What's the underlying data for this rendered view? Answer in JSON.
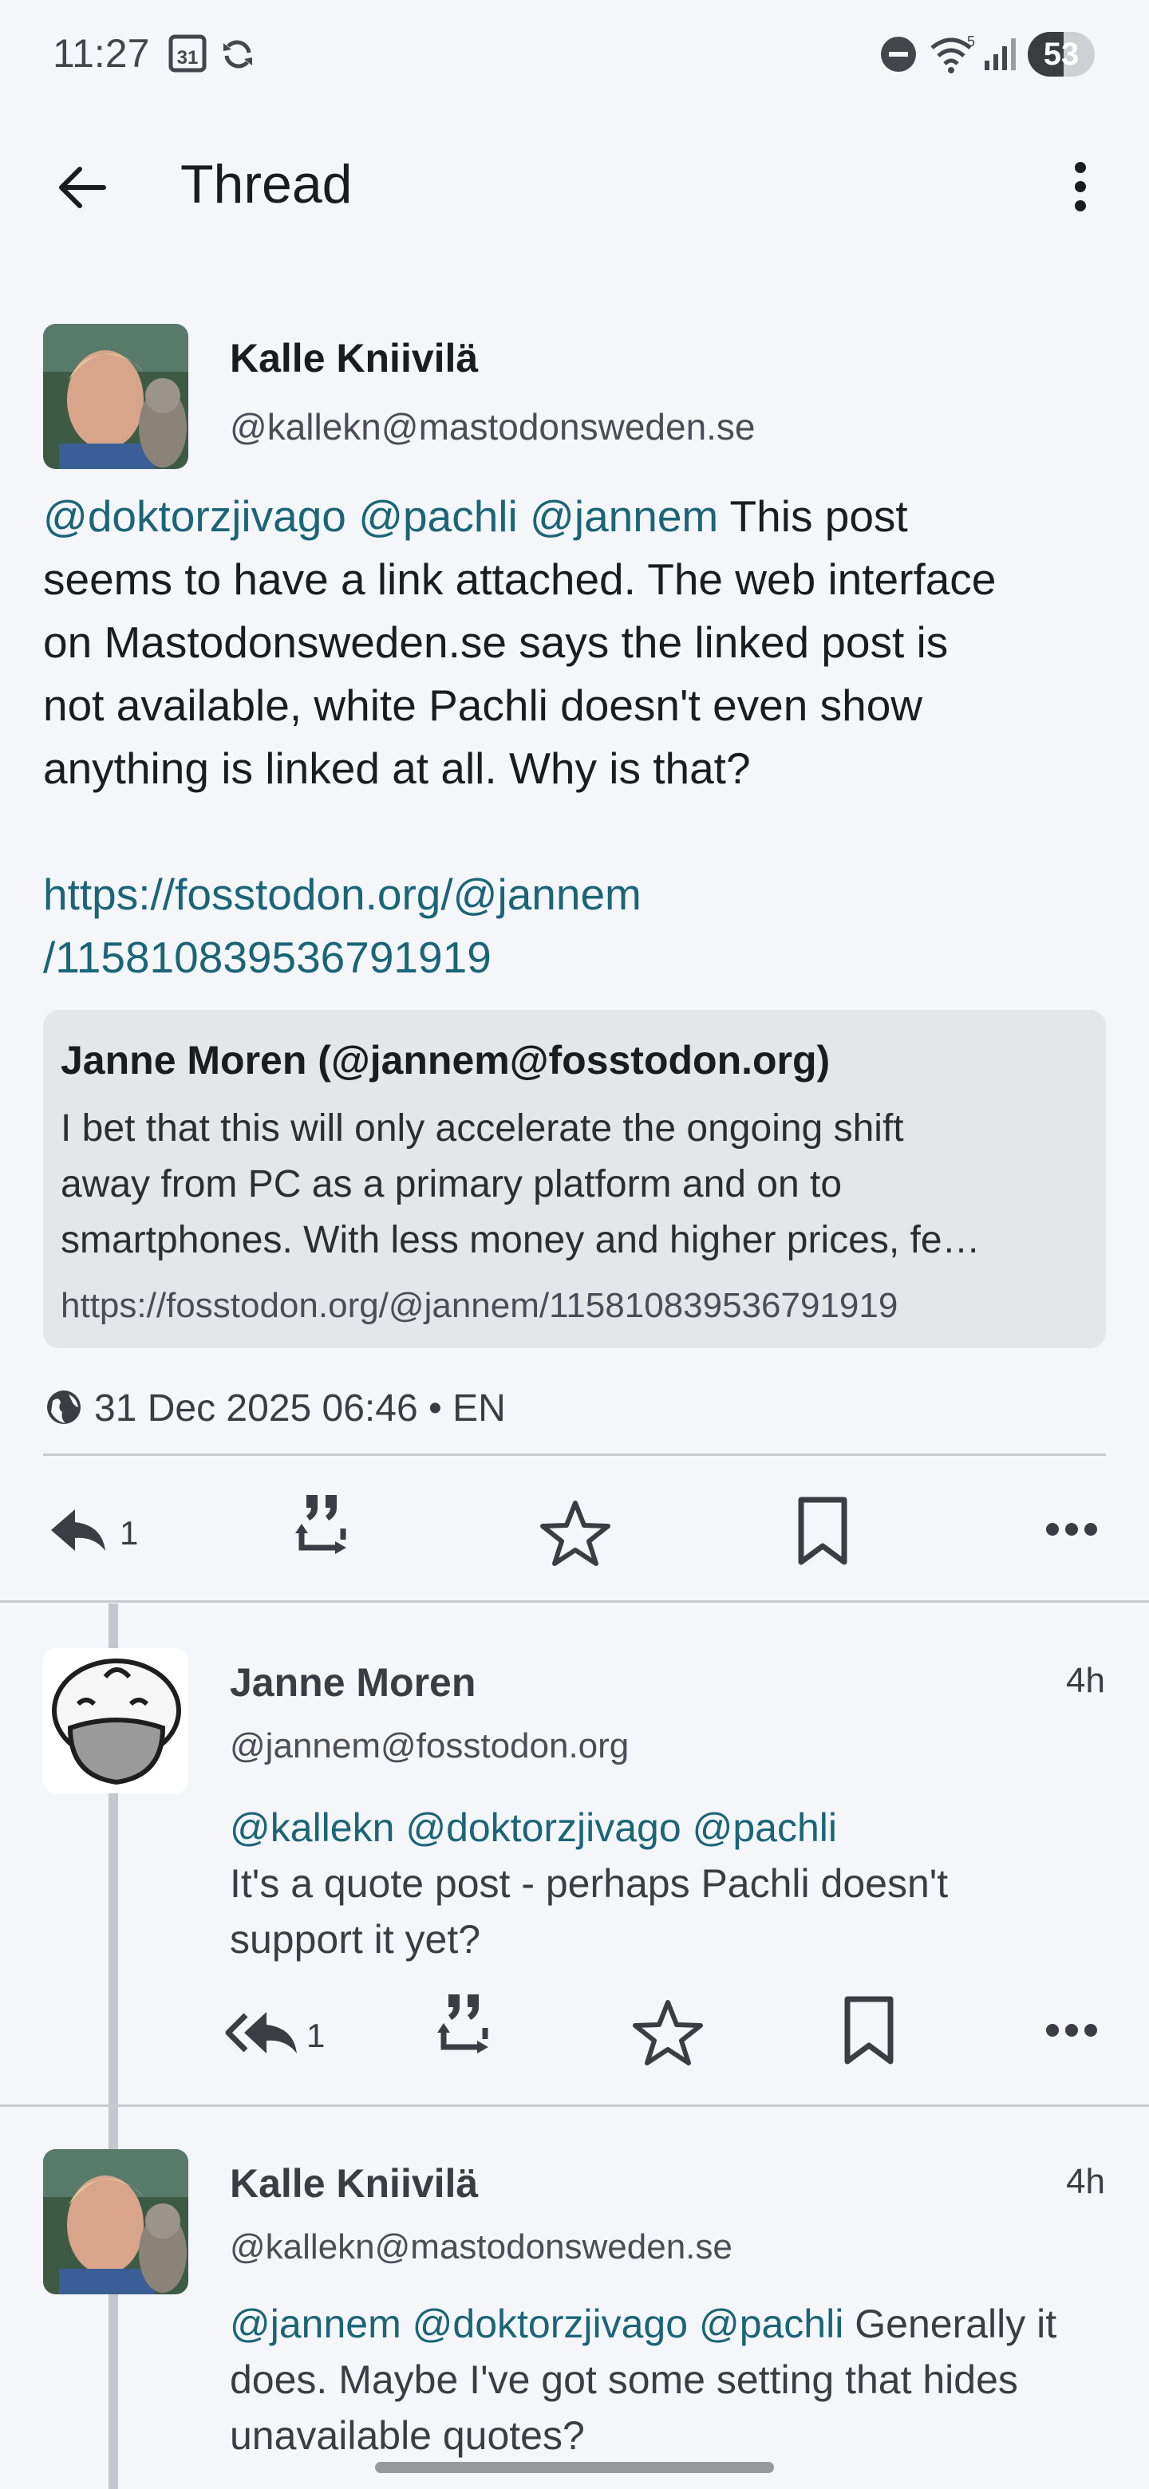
{
  "status_bar": {
    "time": "11:27",
    "calendar_day": "31",
    "network": "5",
    "battery": "53",
    "battery_level": 0.53
  },
  "app_bar": {
    "title": "Thread"
  },
  "main_post": {
    "author_name": "Kalle Kniivilä",
    "author_handle": "@kallekn@mastodonsweden.se",
    "mentions": [
      "@doktorzjivago",
      "@pachli",
      "@jannem"
    ],
    "text_lines": [
      "This post",
      "seems to have a link attached. The web interface",
      "on Mastodonsweden.se says the linked post is",
      "not available, white Pachli doesn't even show",
      "anything is linked at all. Why is that?"
    ],
    "link_lines": [
      "https://fosstodon.org/@jannem",
      "/115810839536791919"
    ],
    "quote": {
      "author": "Janne Moren (@jannem@fosstodon.org)",
      "text_lines": [
        "I bet that this will only accelerate the ongoing shift",
        "away from PC as a primary platform and on to",
        "smartphones. With less money and higher prices, fe…"
      ],
      "url": "https://fosstodon.org/@jannem/115810839536791919"
    },
    "meta": "31 Dec 2025 06:46 • EN",
    "reply_count": "1"
  },
  "reply1": {
    "author_name": "Janne Moren",
    "author_handle": "@jannem@fosstodon.org",
    "time": "4h",
    "mentions": [
      "@kallekn",
      "@doktorzjivago",
      "@pachli"
    ],
    "text_lines": [
      "It's a quote post - perhaps Pachli doesn't",
      "support it yet?"
    ],
    "reply_count": "1"
  },
  "reply2": {
    "author_name": "Kalle Kniivilä",
    "author_handle": "@kallekn@mastodonsweden.se",
    "time": "4h",
    "mentions": [
      "@jannem",
      "@doktorzjivago",
      "@pachli"
    ],
    "text_lines": [
      "Generally it",
      "does. Maybe I've got some setting that hides",
      "unavailable quotes?"
    ]
  },
  "colors": {
    "accent": "#1a6578",
    "background": "#f5f6fa",
    "quote_bg": "#e5e6e9"
  }
}
